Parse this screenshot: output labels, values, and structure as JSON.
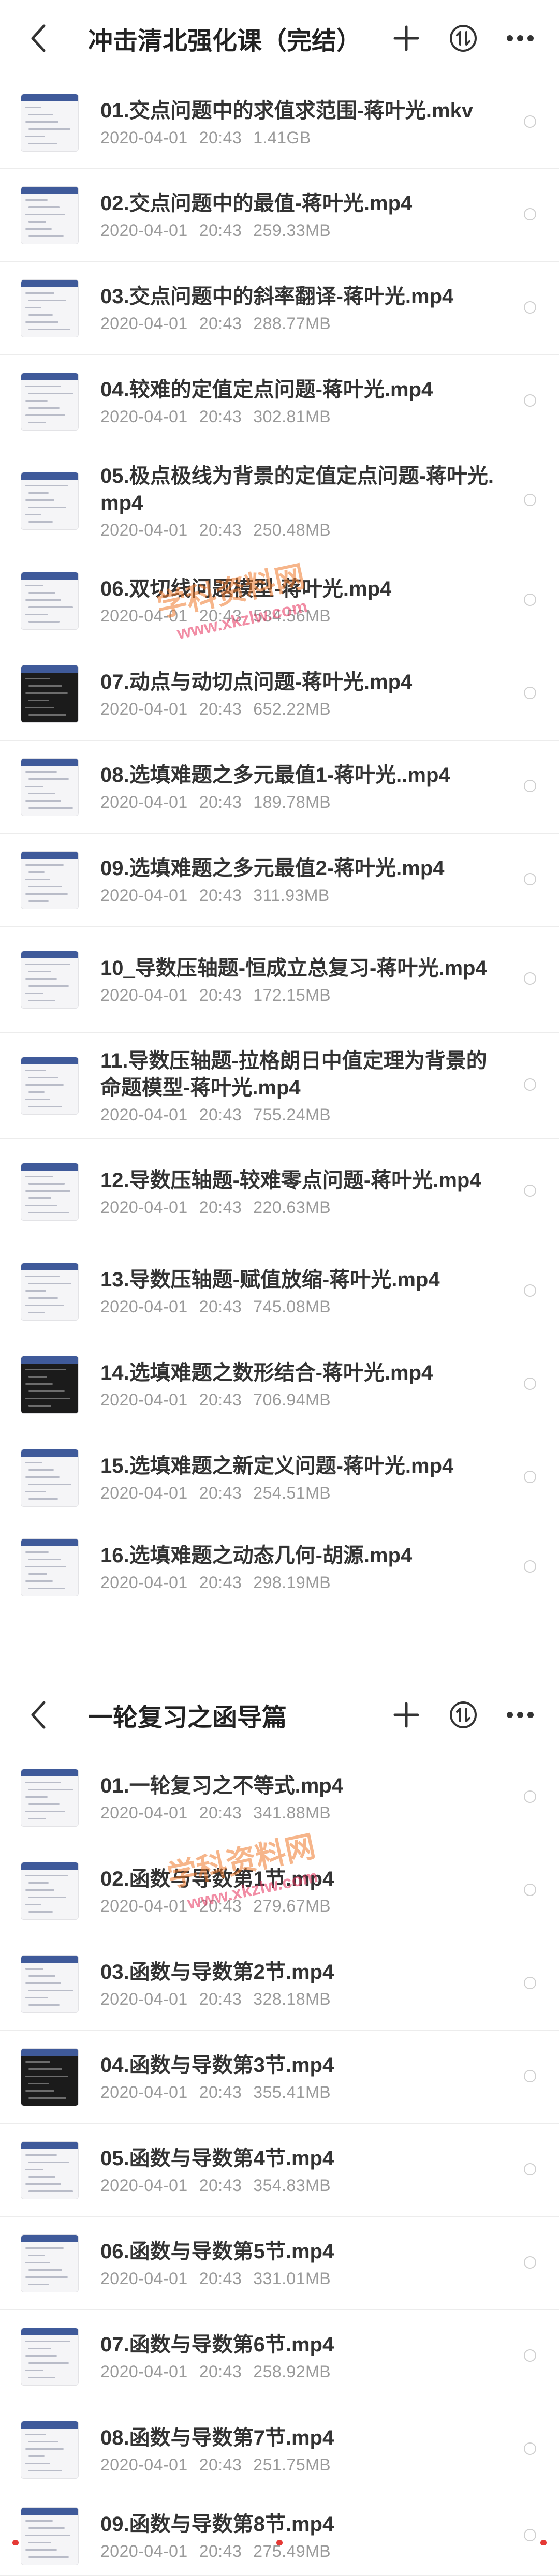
{
  "panel1": {
    "title": "冲击清北强化课（完结）",
    "items": [
      {
        "name": "01.交点问题中的求值求范围-蒋叶光.mkv",
        "date": "2020-04-01",
        "time": "20:43",
        "size": "1.41GB"
      },
      {
        "name": "02.交点问题中的最值-蒋叶光.mp4",
        "date": "2020-04-01",
        "time": "20:43",
        "size": "259.33MB"
      },
      {
        "name": "03.交点问题中的斜率翻译-蒋叶光.mp4",
        "date": "2020-04-01",
        "time": "20:43",
        "size": "288.77MB"
      },
      {
        "name": "04.较难的定值定点问题-蒋叶光.mp4",
        "date": "2020-04-01",
        "time": "20:43",
        "size": "302.81MB"
      },
      {
        "name": "05.极点极线为背景的定值定点问题-蒋叶光.mp4",
        "date": "2020-04-01",
        "time": "20:43",
        "size": "250.48MB"
      },
      {
        "name": "06.双切线问题模型-蒋叶光.mp4",
        "date": "2020-04-01",
        "time": "20:43",
        "size": "534.56MB"
      },
      {
        "name": "07.动点与动切点问题-蒋叶光.mp4",
        "date": "2020-04-01",
        "time": "20:43",
        "size": "652.22MB"
      },
      {
        "name": "08.选填难题之多元最值1-蒋叶光..mp4",
        "date": "2020-04-01",
        "time": "20:43",
        "size": "189.78MB"
      },
      {
        "name": "09.选填难题之多元最值2-蒋叶光.mp4",
        "date": "2020-04-01",
        "time": "20:43",
        "size": "311.93MB"
      },
      {
        "name": "10_导数压轴题-恒成立总复习-蒋叶光.mp4",
        "date": "2020-04-01",
        "time": "20:43",
        "size": "172.15MB"
      },
      {
        "name": "11.导数压轴题-拉格朗日中值定理为背景的命题模型-蒋叶光.mp4",
        "date": "2020-04-01",
        "time": "20:43",
        "size": "755.24MB"
      },
      {
        "name": "12.导数压轴题-较难零点问题-蒋叶光.mp4",
        "date": "2020-04-01",
        "time": "20:43",
        "size": "220.63MB"
      },
      {
        "name": "13.导数压轴题-赋值放缩-蒋叶光.mp4",
        "date": "2020-04-01",
        "time": "20:43",
        "size": "745.08MB"
      },
      {
        "name": "14.选填难题之数形结合-蒋叶光.mp4",
        "date": "2020-04-01",
        "time": "20:43",
        "size": "706.94MB"
      },
      {
        "name": "15.选填难题之新定义问题-蒋叶光.mp4",
        "date": "2020-04-01",
        "time": "20:43",
        "size": "254.51MB"
      },
      {
        "name": "16.选填难题之动态几何-胡源.mp4",
        "date": "2020-04-01",
        "time": "20:43",
        "size": "298.19MB"
      }
    ]
  },
  "panel2": {
    "title": "一轮复习之函导篇",
    "items": [
      {
        "name": "01.一轮复习之不等式.mp4",
        "date": "2020-04-01",
        "time": "20:43",
        "size": "341.88MB"
      },
      {
        "name": "02.函数与导数第1节.mp4",
        "date": "2020-04-01",
        "time": "20:43",
        "size": "279.67MB"
      },
      {
        "name": "03.函数与导数第2节.mp4",
        "date": "2020-04-01",
        "time": "20:43",
        "size": "328.18MB"
      },
      {
        "name": "04.函数与导数第3节.mp4",
        "date": "2020-04-01",
        "time": "20:43",
        "size": "355.41MB"
      },
      {
        "name": "05.函数与导数第4节.mp4",
        "date": "2020-04-01",
        "time": "20:43",
        "size": "354.83MB"
      },
      {
        "name": "06.函数与导数第5节.mp4",
        "date": "2020-04-01",
        "time": "20:43",
        "size": "331.01MB"
      },
      {
        "name": "07.函数与导数第6节.mp4",
        "date": "2020-04-01",
        "time": "20:43",
        "size": "258.92MB"
      },
      {
        "name": "08.函数与导数第7节.mp4",
        "date": "2020-04-01",
        "time": "20:43",
        "size": "251.75MB"
      },
      {
        "name": "09.函数与导数第8节.mp4",
        "date": "2020-04-01",
        "time": "20:43",
        "size": "275.49MB"
      }
    ]
  },
  "watermark": {
    "text": "学科资料网",
    "url": "www.xkzlw.com"
  },
  "icons": {
    "back": "back-arrow-icon",
    "add": "plus-icon",
    "sort": "sort-icon",
    "more": "more-icon"
  },
  "colors": {
    "accent": "#3f5a9a",
    "meta": "#9a9a9a",
    "watermark_orange": "#f07a2c",
    "watermark_red": "#e6305b"
  }
}
